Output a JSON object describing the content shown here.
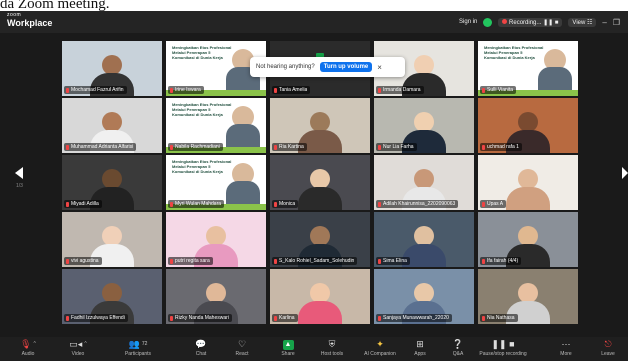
{
  "caption": "da Zoom meeting.",
  "app": {
    "brand_small": "zoom",
    "brand_large": "Workplace"
  },
  "titlebar": {
    "signin": "Sign in",
    "recording": "Recording...",
    "view": "View",
    "minimize": "–",
    "restore": "❐"
  },
  "banner": {
    "message": "Not hearing anything?",
    "button": "Turn up volume",
    "close": "×"
  },
  "page_indicator": "1/3",
  "slide_text": "Meningkatkan Etos Profesional Melalui Penerapan 5 Komunikasi di Dunia Kerja",
  "participants": [
    {
      "name": "Mochamad Fazrul Arifin",
      "kind": "cam",
      "bg": "#c8d2da",
      "skin": "#a07050",
      "cloth": "#333"
    },
    {
      "name": "Irine Iswara",
      "kind": "slide"
    },
    {
      "name": "Tania Amelia",
      "kind": "dark"
    },
    {
      "name": "Irmanda Damara",
      "kind": "cam",
      "bg": "#e6e4df",
      "skin": "#f0cfb2",
      "cloth": "#2a2a2a",
      "active": true
    },
    {
      "name": "Sulli Vianita",
      "kind": "slide"
    },
    {
      "name": "Muhammad Adrianta Alfarisi",
      "kind": "cam",
      "bg": "#d8d8d8",
      "skin": "#b07a56",
      "cloth": "#f0f0f0"
    },
    {
      "name": "Nabila Rachmadiani",
      "kind": "slide"
    },
    {
      "name": "Ria Kartina",
      "kind": "cam",
      "bg": "#cfc6b8",
      "skin": "#9c7a5a",
      "cloth": "#7a5a48"
    },
    {
      "name": "Nur Lia Farha",
      "kind": "cam",
      "bg": "#b8b8b0",
      "skin": "#f0d0b0",
      "cloth": "#1e2a3a"
    },
    {
      "name": "uchmad rafa 1",
      "kind": "cam",
      "bg": "#b86a40",
      "skin": "#7a4a30",
      "cloth": "#3a2a2a"
    },
    {
      "name": "Miyadi Adilla",
      "kind": "cam",
      "bg": "#3a3a3a",
      "skin": "#6a4a30",
      "cloth": "#222"
    },
    {
      "name": "Myri Wulan Mahdara",
      "kind": "slide"
    },
    {
      "name": "Monica",
      "kind": "cam",
      "bg": "#4a4a50",
      "skin": "#e8c8a8",
      "cloth": "#2a2a2a"
    },
    {
      "name": "Adilah Khairunnisa_2202090063",
      "kind": "cam",
      "bg": "#e0dcd8",
      "skin": "#c89878",
      "cloth": "#e8e8e8"
    },
    {
      "name": "Upas A",
      "kind": "cam",
      "bg": "#f0ece6",
      "skin": "#e0b898",
      "cloth": "#d0a080"
    },
    {
      "name": "vivi agustina",
      "kind": "cam",
      "bg": "#c0b8b0",
      "skin": "#f0d0b8",
      "cloth": "#f0f0f0"
    },
    {
      "name": "putri regita sara",
      "kind": "cam",
      "bg": "#f5d8e6",
      "skin": "#e8c0a0",
      "cloth": "#e89ac0"
    },
    {
      "name": "S_Kalo Rohiel_Sadam_Solehudin",
      "kind": "cam",
      "bg": "#3a4048",
      "skin": "#a07858",
      "cloth": "#1f2a35"
    },
    {
      "name": "Sima Elina",
      "kind": "cam",
      "bg": "#4a5a6a",
      "skin": "#e0c0a0",
      "cloth": "#3a4a6a"
    },
    {
      "name": "Ifa fairah (4/4)",
      "kind": "cam",
      "bg": "#8a9098",
      "skin": "#e0b890",
      "cloth": "#2a2a2a"
    },
    {
      "name": "Fadhil Izzulwaya Effendi",
      "kind": "cam",
      "bg": "#5a6070",
      "skin": "#8a6040",
      "cloth": "#3a3a3a"
    },
    {
      "name": "Rizky Nanda Maheswari",
      "kind": "cam",
      "bg": "#6a6a70",
      "skin": "#e0b898",
      "cloth": "#4a4a50"
    },
    {
      "name": "Karlina",
      "kind": "cam",
      "bg": "#c8b8a8",
      "skin": "#f0c8a8",
      "cloth": "#e85a7a"
    },
    {
      "name": "Sanjaya Munawwarah_22020",
      "kind": "cam",
      "bg": "#7a90a8",
      "skin": "#e8c8a8",
      "cloth": "#5a7090"
    },
    {
      "name": "Nia Nathasa",
      "kind": "cam",
      "bg": "#8a8070",
      "skin": "#e8c0a0",
      "cloth": "#d0d0d0"
    }
  ],
  "toolbar": {
    "audio": "Audio",
    "video": "Video",
    "participants": "Participants",
    "participants_count": "72",
    "chat": "Chat",
    "react": "React",
    "share": "Share",
    "host_tools": "Host tools",
    "ai_companion": "AI Companion",
    "apps": "Apps",
    "qa": "Q&A",
    "pause_recording": "Pause/stop recording",
    "more": "More",
    "leave": "Leave"
  }
}
